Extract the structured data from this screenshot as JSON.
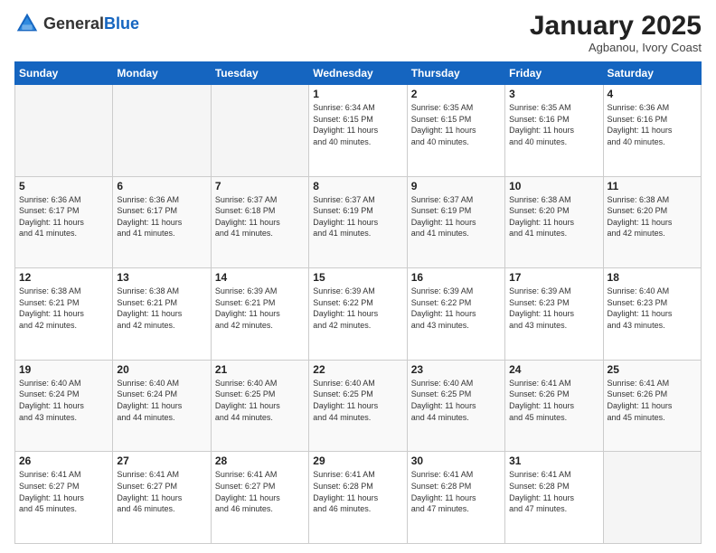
{
  "header": {
    "logo_general": "General",
    "logo_blue": "Blue",
    "month_title": "January 2025",
    "subtitle": "Agbanou, Ivory Coast"
  },
  "days_of_week": [
    "Sunday",
    "Monday",
    "Tuesday",
    "Wednesday",
    "Thursday",
    "Friday",
    "Saturday"
  ],
  "weeks": [
    [
      {
        "day": "",
        "info": ""
      },
      {
        "day": "",
        "info": ""
      },
      {
        "day": "",
        "info": ""
      },
      {
        "day": "1",
        "info": "Sunrise: 6:34 AM\nSunset: 6:15 PM\nDaylight: 11 hours\nand 40 minutes."
      },
      {
        "day": "2",
        "info": "Sunrise: 6:35 AM\nSunset: 6:15 PM\nDaylight: 11 hours\nand 40 minutes."
      },
      {
        "day": "3",
        "info": "Sunrise: 6:35 AM\nSunset: 6:16 PM\nDaylight: 11 hours\nand 40 minutes."
      },
      {
        "day": "4",
        "info": "Sunrise: 6:36 AM\nSunset: 6:16 PM\nDaylight: 11 hours\nand 40 minutes."
      }
    ],
    [
      {
        "day": "5",
        "info": "Sunrise: 6:36 AM\nSunset: 6:17 PM\nDaylight: 11 hours\nand 41 minutes."
      },
      {
        "day": "6",
        "info": "Sunrise: 6:36 AM\nSunset: 6:17 PM\nDaylight: 11 hours\nand 41 minutes."
      },
      {
        "day": "7",
        "info": "Sunrise: 6:37 AM\nSunset: 6:18 PM\nDaylight: 11 hours\nand 41 minutes."
      },
      {
        "day": "8",
        "info": "Sunrise: 6:37 AM\nSunset: 6:19 PM\nDaylight: 11 hours\nand 41 minutes."
      },
      {
        "day": "9",
        "info": "Sunrise: 6:37 AM\nSunset: 6:19 PM\nDaylight: 11 hours\nand 41 minutes."
      },
      {
        "day": "10",
        "info": "Sunrise: 6:38 AM\nSunset: 6:20 PM\nDaylight: 11 hours\nand 41 minutes."
      },
      {
        "day": "11",
        "info": "Sunrise: 6:38 AM\nSunset: 6:20 PM\nDaylight: 11 hours\nand 42 minutes."
      }
    ],
    [
      {
        "day": "12",
        "info": "Sunrise: 6:38 AM\nSunset: 6:21 PM\nDaylight: 11 hours\nand 42 minutes."
      },
      {
        "day": "13",
        "info": "Sunrise: 6:38 AM\nSunset: 6:21 PM\nDaylight: 11 hours\nand 42 minutes."
      },
      {
        "day": "14",
        "info": "Sunrise: 6:39 AM\nSunset: 6:21 PM\nDaylight: 11 hours\nand 42 minutes."
      },
      {
        "day": "15",
        "info": "Sunrise: 6:39 AM\nSunset: 6:22 PM\nDaylight: 11 hours\nand 42 minutes."
      },
      {
        "day": "16",
        "info": "Sunrise: 6:39 AM\nSunset: 6:22 PM\nDaylight: 11 hours\nand 43 minutes."
      },
      {
        "day": "17",
        "info": "Sunrise: 6:39 AM\nSunset: 6:23 PM\nDaylight: 11 hours\nand 43 minutes."
      },
      {
        "day": "18",
        "info": "Sunrise: 6:40 AM\nSunset: 6:23 PM\nDaylight: 11 hours\nand 43 minutes."
      }
    ],
    [
      {
        "day": "19",
        "info": "Sunrise: 6:40 AM\nSunset: 6:24 PM\nDaylight: 11 hours\nand 43 minutes."
      },
      {
        "day": "20",
        "info": "Sunrise: 6:40 AM\nSunset: 6:24 PM\nDaylight: 11 hours\nand 44 minutes."
      },
      {
        "day": "21",
        "info": "Sunrise: 6:40 AM\nSunset: 6:25 PM\nDaylight: 11 hours\nand 44 minutes."
      },
      {
        "day": "22",
        "info": "Sunrise: 6:40 AM\nSunset: 6:25 PM\nDaylight: 11 hours\nand 44 minutes."
      },
      {
        "day": "23",
        "info": "Sunrise: 6:40 AM\nSunset: 6:25 PM\nDaylight: 11 hours\nand 44 minutes."
      },
      {
        "day": "24",
        "info": "Sunrise: 6:41 AM\nSunset: 6:26 PM\nDaylight: 11 hours\nand 45 minutes."
      },
      {
        "day": "25",
        "info": "Sunrise: 6:41 AM\nSunset: 6:26 PM\nDaylight: 11 hours\nand 45 minutes."
      }
    ],
    [
      {
        "day": "26",
        "info": "Sunrise: 6:41 AM\nSunset: 6:27 PM\nDaylight: 11 hours\nand 45 minutes."
      },
      {
        "day": "27",
        "info": "Sunrise: 6:41 AM\nSunset: 6:27 PM\nDaylight: 11 hours\nand 46 minutes."
      },
      {
        "day": "28",
        "info": "Sunrise: 6:41 AM\nSunset: 6:27 PM\nDaylight: 11 hours\nand 46 minutes."
      },
      {
        "day": "29",
        "info": "Sunrise: 6:41 AM\nSunset: 6:28 PM\nDaylight: 11 hours\nand 46 minutes."
      },
      {
        "day": "30",
        "info": "Sunrise: 6:41 AM\nSunset: 6:28 PM\nDaylight: 11 hours\nand 47 minutes."
      },
      {
        "day": "31",
        "info": "Sunrise: 6:41 AM\nSunset: 6:28 PM\nDaylight: 11 hours\nand 47 minutes."
      },
      {
        "day": "",
        "info": ""
      }
    ]
  ]
}
